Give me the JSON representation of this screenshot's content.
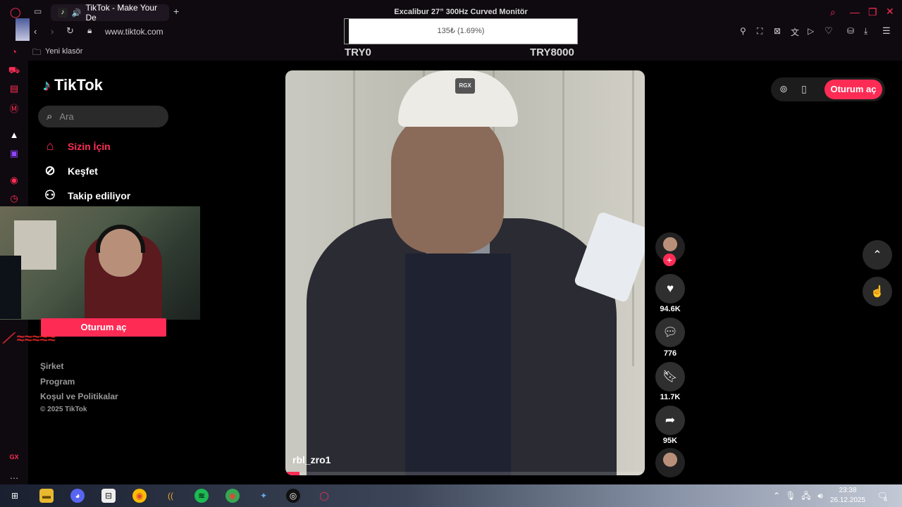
{
  "browser": {
    "tab_title": "TikTok - Make Your De",
    "url": "www.tiktok.com",
    "bookmark_folder": "Yeni klasör",
    "accent_color": "#ff2d55"
  },
  "overlay": {
    "title": "Excalibur 27” 300Hz Curved Monitör",
    "progress_text": "135₺ (1.69%)",
    "progress_fraction": 0.0169,
    "min_label": "TRY0",
    "max_label": "TRY8000"
  },
  "tiktok": {
    "logo_text": "TikTok",
    "search_placeholder": "Ara",
    "nav": [
      {
        "label": "Sizin İçin",
        "icon": "home-icon",
        "active": true
      },
      {
        "label": "Keşfet",
        "icon": "compass-icon",
        "active": false
      },
      {
        "label": "Takip ediliyor",
        "icon": "user-follow-icon",
        "active": false
      }
    ],
    "login_button": "Oturum aç",
    "footer": [
      "Şirket",
      "Program",
      "Koşul ve Politikalar",
      "© 2025 TikTok"
    ],
    "brand_color": "#fe2c55"
  },
  "video": {
    "watermark": "RGX",
    "username": "rbl_zro1",
    "progress_fraction": 0.04,
    "likes": "94.6K",
    "comments": "776",
    "saves": "11.7K",
    "shares": "95K"
  },
  "top_right": {
    "login_button": "Oturum aç"
  },
  "taskbar": {
    "time": "23:38",
    "date": "26.12.2025",
    "notification_count": "4"
  }
}
